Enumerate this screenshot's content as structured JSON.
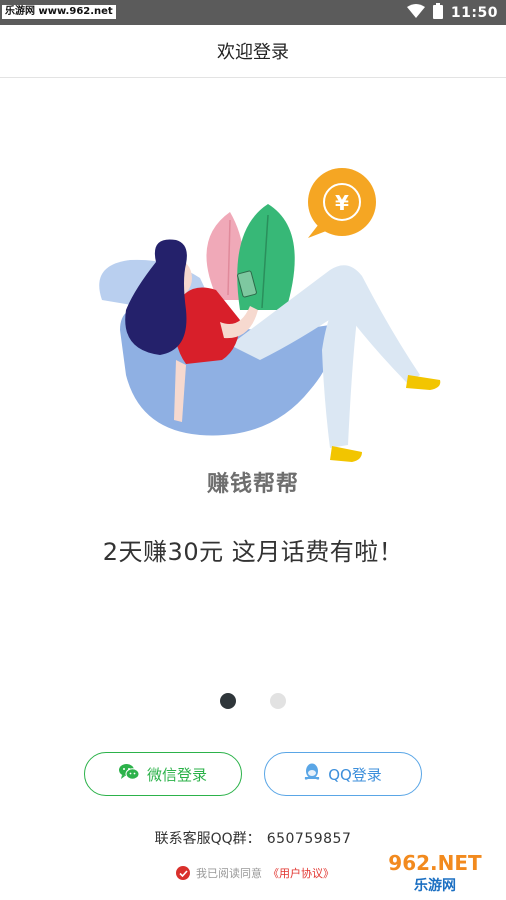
{
  "status_bar": {
    "watermark": "乐游网 www.962.net",
    "time": "11:50"
  },
  "header": {
    "title": "欢迎登录"
  },
  "intro": {
    "app_name": "赚钱帮帮",
    "slogan": "2天赚30元  这月话费有啦！",
    "coin_symbol": "¥"
  },
  "pager": {
    "count": 2,
    "active_index": 0
  },
  "login": {
    "wechat_label": "微信登录",
    "qq_label": "QQ登录"
  },
  "contact": {
    "label": "联系客服QQ群：",
    "number": "650759857"
  },
  "agreement": {
    "prefix": "我已阅读同意",
    "link": "《用户协议》",
    "checked": true
  },
  "watermark_corner": {
    "top": "962.NET",
    "bottom": "乐游网"
  },
  "colors": {
    "status_bar": "#5b5b5b",
    "wechat": "#2cb24a",
    "qq": "#5aa6e6",
    "agreement_link": "#e2352f",
    "coin": "#f5a623"
  }
}
